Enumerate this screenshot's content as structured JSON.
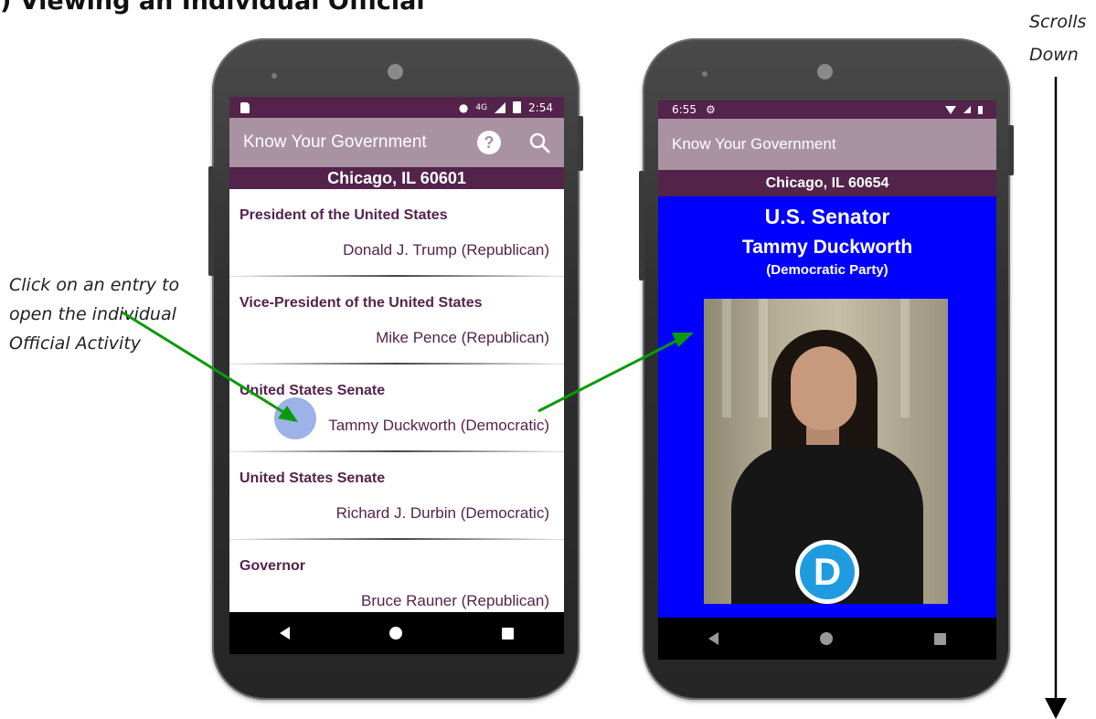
{
  "heading": ")  Viewing an Individual Official",
  "caption": "Click on an entry to open the individual Official Activity",
  "scroll_note": "Scrolls Down",
  "phone1": {
    "status": {
      "time": "2:54",
      "signal": "4G"
    },
    "app_title": "Know Your Government",
    "location": "Chicago, IL 60601",
    "entries": [
      {
        "office": "President of the United States",
        "official": "Donald J. Trump (Republican)"
      },
      {
        "office": "Vice-President of the United States",
        "official": "Mike Pence (Republican)"
      },
      {
        "office": "United States Senate",
        "official": "Tammy Duckworth (Democratic)"
      },
      {
        "office": "United States Senate",
        "official": "Richard J. Durbin (Democratic)"
      },
      {
        "office": "Governor",
        "official": "Bruce Rauner (Republican)"
      }
    ]
  },
  "phone2": {
    "status": {
      "time": "6:55"
    },
    "app_title": "Know Your Government",
    "location": "Chicago, IL 60654",
    "office": "U.S. Senator",
    "name": "Tammy Duckworth",
    "party": "(Democratic Party)",
    "party_logo_letter": "D"
  },
  "icons": {
    "help": "help-icon",
    "search": "search-icon",
    "back": "back-nav-icon",
    "home": "home-nav-icon",
    "recents": "recents-nav-icon"
  },
  "colors": {
    "status_bar": "#54234c",
    "app_bar": "#a992a1",
    "detail_background": "#0000ff",
    "arrow": "#0a9a0a",
    "democratic_blue": "#1f9be0"
  }
}
